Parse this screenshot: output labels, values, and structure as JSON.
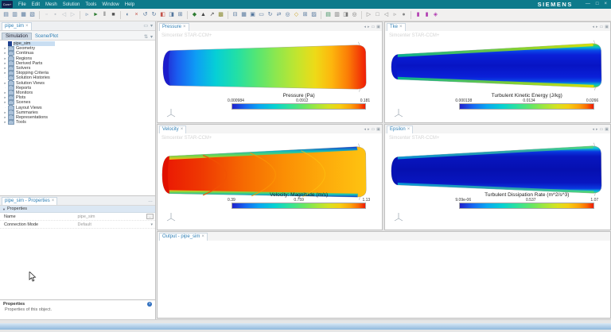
{
  "titlebar": {
    "app_icon": "Ccm+",
    "menus": [
      "File",
      "Edit",
      "Mesh",
      "Solution",
      "Tools",
      "Window",
      "Help"
    ],
    "brand": "SIEMENS",
    "window_controls": {
      "minimize": "—",
      "maximize": "□",
      "close": "×"
    }
  },
  "toolbar": {
    "groups": [
      [
        {
          "name": "new-simulation",
          "glyph": "▤",
          "color": "#54769c"
        },
        {
          "name": "load-simulation",
          "glyph": "▥",
          "color": "#54769c"
        },
        {
          "name": "save",
          "glyph": "▦",
          "color": "#54769c"
        },
        {
          "name": "save-all",
          "glyph": "▧",
          "color": "#54769c"
        }
      ],
      [
        {
          "name": "cut",
          "glyph": "▫",
          "color": "#b9bec4"
        },
        {
          "name": "copy",
          "glyph": "▪",
          "color": "#b9bec4"
        },
        {
          "name": "undo",
          "glyph": "◁",
          "color": "#b9bec4"
        },
        {
          "name": "redo",
          "glyph": "▷",
          "color": "#b9bec4"
        }
      ],
      [
        {
          "name": "step",
          "glyph": "▹",
          "color": "#54769c"
        },
        {
          "name": "run",
          "glyph": "►",
          "color": "#2e7d32"
        },
        {
          "name": "pause",
          "glyph": "‖",
          "color": "#555555"
        },
        {
          "name": "stop",
          "glyph": "■",
          "color": "#555555"
        }
      ],
      [
        {
          "name": "initialize-solution",
          "glyph": "◐",
          "color": "#54769c"
        },
        {
          "name": "clear-solution",
          "glyph": "×",
          "color": "#c3524a"
        },
        {
          "name": "reset-view",
          "glyph": "↺",
          "color": "#54769c"
        },
        {
          "name": "restore-view",
          "glyph": "↻",
          "color": "#54769c"
        },
        {
          "name": "edit-tool",
          "glyph": "◧",
          "color": "#c3524a"
        },
        {
          "name": "mirror-tool",
          "glyph": "◨",
          "color": "#54769c"
        },
        {
          "name": "duplicate",
          "glyph": "⊞",
          "color": "#54769c"
        }
      ],
      [
        {
          "name": "generate-mesh",
          "glyph": "◆",
          "color": "#2e7d32"
        },
        {
          "name": "select-tool",
          "glyph": "▲",
          "color": "#444444"
        },
        {
          "name": "probe-tool",
          "glyph": "↗",
          "color": "#444444"
        },
        {
          "name": "snapshot",
          "glyph": "▩",
          "color": "#8a8a30"
        }
      ],
      [
        {
          "name": "save-scene",
          "glyph": "⊟",
          "color": "#54769c"
        },
        {
          "name": "scene-grid",
          "glyph": "▦",
          "color": "#54769c"
        },
        {
          "name": "scene-table",
          "glyph": "▣",
          "color": "#54769c"
        },
        {
          "name": "rubberband-select",
          "glyph": "▭",
          "color": "#54769c"
        },
        {
          "name": "rotate-view",
          "glyph": "↻",
          "color": "#54769c"
        },
        {
          "name": "pan-view",
          "glyph": "⇄",
          "color": "#54769c"
        },
        {
          "name": "zoom-view",
          "glyph": "◎",
          "color": "#54769c"
        },
        {
          "name": "highlight-tool",
          "glyph": "◇",
          "color": "#c8a020"
        },
        {
          "name": "window-layout",
          "glyph": "⊞",
          "color": "#54769c"
        },
        {
          "name": "perspective-toggle",
          "glyph": "▨",
          "color": "#54769c"
        }
      ],
      [
        {
          "name": "new-plot",
          "glyph": "▤",
          "color": "#3f8f5f"
        },
        {
          "name": "table-view",
          "glyph": "▥",
          "color": "#777777"
        },
        {
          "name": "link-views",
          "glyph": "◨",
          "color": "#777777"
        },
        {
          "name": "sync-views",
          "glyph": "◎",
          "color": "#777777"
        }
      ],
      [
        {
          "name": "play-animation",
          "glyph": "▷",
          "color": "#888888"
        },
        {
          "name": "stop-animation",
          "glyph": "□",
          "color": "#888888"
        },
        {
          "name": "step-back",
          "glyph": "◁",
          "color": "#888888"
        },
        {
          "name": "step-forward",
          "glyph": "▹",
          "color": "#888888"
        },
        {
          "name": "record-animation",
          "glyph": "●",
          "color": "#888888"
        }
      ],
      [
        {
          "name": "macro-record",
          "glyph": "▮",
          "color": "#b03ab0"
        },
        {
          "name": "macro-play",
          "glyph": "▮",
          "color": "#b03ab0"
        },
        {
          "name": "macro-pause",
          "glyph": "◈",
          "color": "#b03ab0"
        }
      ]
    ]
  },
  "explorer": {
    "doc_tab": "pipe_sim",
    "view_tabs": {
      "simulation": "Simulation",
      "scene_plot": "Scene/Plot"
    },
    "root": "pipe_sim",
    "tree": [
      {
        "label": "Geometry",
        "expandable": true
      },
      {
        "label": "Continua",
        "expandable": true
      },
      {
        "label": "Regions",
        "expandable": true
      },
      {
        "label": "Derived Parts",
        "expandable": true
      },
      {
        "label": "Solvers",
        "expandable": true
      },
      {
        "label": "Stopping Criteria",
        "expandable": true
      },
      {
        "label": "Solution Histories",
        "expandable": false
      },
      {
        "label": "Solution Views",
        "expandable": true
      },
      {
        "label": "Reports",
        "expandable": false
      },
      {
        "label": "Monitors",
        "expandable": true
      },
      {
        "label": "Plots",
        "expandable": true
      },
      {
        "label": "Scenes",
        "expandable": true
      },
      {
        "label": "Layout Views",
        "expandable": false
      },
      {
        "label": "Summaries",
        "expandable": true
      },
      {
        "label": "Representations",
        "expandable": true
      },
      {
        "label": "Tools",
        "expandable": true
      }
    ]
  },
  "properties_panel": {
    "tab": "pipe_sim - Properties",
    "section": "Properties",
    "rows": [
      {
        "label": "Name",
        "value": "pipe_sim"
      },
      {
        "label": "Connection Mode",
        "value": "Default"
      }
    ]
  },
  "help_panel": {
    "title": "Properties",
    "description": "Properties of this object.",
    "help_glyph": "?"
  },
  "output_panel": {
    "tab": "Output - pipe_sim"
  },
  "viewports": [
    {
      "tab": "Pressure",
      "watermark": "Simcenter STAR-CCM+",
      "colorbar": {
        "title": "Pressure (Pa)",
        "min": "0.000984",
        "mid": "0.0912",
        "max": "0.181"
      }
    },
    {
      "tab": "Tke",
      "watermark": "Simcenter STAR-CCM+",
      "colorbar": {
        "title": "Turbulent Kinetic Energy (J/kg)",
        "min": "0.000138",
        "mid": "0.0134",
        "max": "0.0266"
      }
    },
    {
      "tab": "Velocity",
      "watermark": "Simcenter STAR-CCM+",
      "colorbar": {
        "title": "Velocity: Magnitude (m/s)",
        "min": "0.39",
        "mid": "0.759",
        "max": "1.13"
      }
    },
    {
      "tab": "Epsilon",
      "watermark": "Simcenter STAR-CCM+",
      "colorbar": {
        "title": "Turbulent Dissipation Rate (m^2/s^3)",
        "min": "9.09e-06",
        "mid": "0.537",
        "max": "1.07"
      }
    }
  ],
  "colors": {
    "titlebar_teal": "#0e7a8b",
    "colormap": [
      "#2121cc",
      "#07d2d2",
      "#67e763",
      "#f6cf12",
      "#ee1a04"
    ],
    "selection_blue": "#c9def2"
  }
}
